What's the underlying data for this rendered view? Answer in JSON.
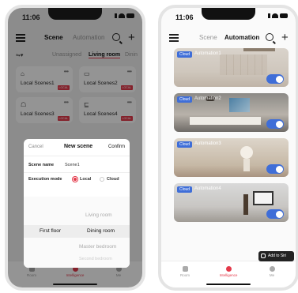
{
  "left": {
    "time": "11:06",
    "tabs": {
      "scene": "Scene",
      "automation": "Automation"
    },
    "filter": {
      "icon": "filter-icon",
      "items": [
        "Unassigned",
        "Living room",
        "Dinin"
      ]
    },
    "scenes": [
      {
        "label": "Local Scenes1",
        "badge": "LOCAL"
      },
      {
        "label": "Local Scenes2",
        "badge": "LOCAL"
      },
      {
        "label": "Local Scenes3",
        "badge": "LOCAL"
      },
      {
        "label": "Local Scenes4",
        "badge": "LOCAL"
      }
    ],
    "dialog": {
      "cancel": "Cancel",
      "title": "New scene",
      "confirm": "Confirm",
      "scene_name_label": "Scene name",
      "scene_name_value": "Scene1",
      "exec_label": "Execution mode",
      "local": "Local",
      "cloud": "Cloud",
      "picker_left": [
        "",
        "First floor",
        ""
      ],
      "picker_right": [
        "Living room",
        "Dining room",
        "Master bedroom",
        "Second bedroom"
      ]
    },
    "nav": [
      "Room",
      "Intelligence",
      "Me"
    ]
  },
  "right": {
    "time": "11:06",
    "tabs": {
      "scene": "Scene",
      "automation": "Automation"
    },
    "automations": [
      {
        "tag": "Cloud",
        "name": "Automation1",
        "enabled": true
      },
      {
        "tag": "Cloud",
        "name": "Automation2",
        "enabled": true
      },
      {
        "tag": "Cloud",
        "name": "Automation3",
        "enabled": true
      },
      {
        "tag": "Cloud",
        "name": "Automation4",
        "enabled": true
      }
    ],
    "siri_label": "Add to Siri",
    "nav": [
      "Room",
      "Intelligence",
      "Me"
    ]
  },
  "colors": {
    "accent": "#e4394a",
    "toggle": "#3f6ed8"
  }
}
